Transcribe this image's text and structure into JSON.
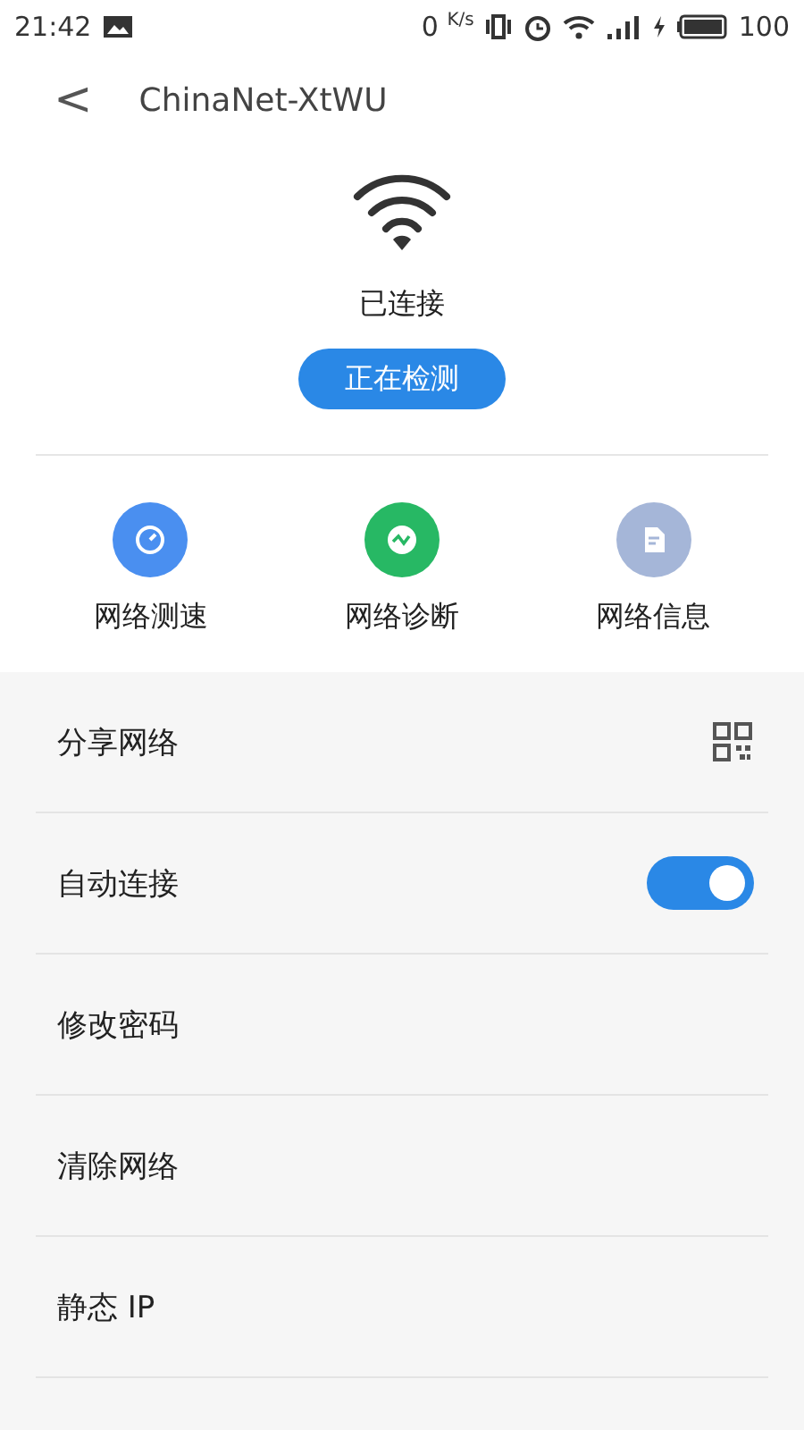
{
  "status_bar": {
    "time": "21:42",
    "speed": "0",
    "speed_unit": "K/s",
    "battery": "100"
  },
  "header": {
    "back": "<",
    "title": "ChinaNet-XtWU"
  },
  "connection": {
    "status": "已连接",
    "button": "正在检测"
  },
  "actions": [
    {
      "label": "网络测速",
      "color": "#4a8ff0",
      "kind": "speed"
    },
    {
      "label": "网络诊断",
      "color": "#27b864",
      "kind": "diagnose"
    },
    {
      "label": "网络信息",
      "color": "#a5b6d8",
      "kind": "info"
    }
  ],
  "settings": [
    {
      "label": "分享网络",
      "kind": "qr"
    },
    {
      "label": "自动连接",
      "kind": "toggle",
      "on": true
    },
    {
      "label": "修改密码",
      "kind": "plain"
    },
    {
      "label": "清除网络",
      "kind": "plain"
    },
    {
      "label": "静态 IP",
      "kind": "plain"
    }
  ]
}
